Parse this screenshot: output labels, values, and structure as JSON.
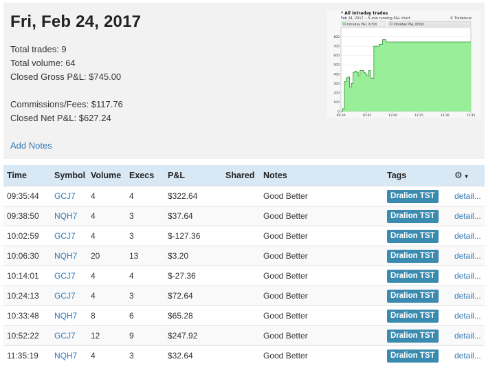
{
  "summary": {
    "date": "Fri, Feb 24, 2017",
    "total_trades": "Total trades: 9",
    "total_volume": "Total volume: 64",
    "closed_gross": "Closed Gross P&L: $745.00",
    "commissions": "Commissions/Fees: $117.76",
    "closed_net": "Closed Net P&L: $627.24",
    "add_notes": "Add Notes"
  },
  "chart_data": {
    "type": "area",
    "title": "* All intraday trades",
    "subtitle": "Feb 24, 2017 -- 5-min running P&L chart",
    "brand": "© Tradervue",
    "legend": [
      "Intraday P&L (USD)",
      "Intraday P&L (USD)"
    ],
    "x_ticks": [
      "09:30",
      "10:45",
      "12:00",
      "13:15",
      "14:30",
      "15:45"
    ],
    "y_ticks": [
      0,
      100,
      200,
      300,
      400,
      500,
      600,
      700,
      800
    ],
    "ylim": [
      0,
      900
    ],
    "series": [
      {
        "name": "Intraday P&L (USD)",
        "x": [
          "09:30",
          "09:35",
          "09:40",
          "09:45",
          "09:50",
          "09:55",
          "10:00",
          "10:05",
          "10:10",
          "10:15",
          "10:20",
          "10:25",
          "10:30",
          "10:35",
          "10:40",
          "10:45",
          "10:50",
          "10:55",
          "11:00",
          "11:05",
          "11:10",
          "11:15",
          "11:20",
          "11:30",
          "11:40",
          "12:00",
          "13:15",
          "14:30",
          "15:45"
        ],
        "values": [
          0,
          30,
          320,
          360,
          370,
          260,
          300,
          420,
          430,
          420,
          380,
          440,
          440,
          420,
          400,
          380,
          440,
          360,
          350,
          700,
          700,
          700,
          720,
          770,
          745,
          745,
          745,
          745,
          745
        ]
      }
    ],
    "colors": {
      "fill": "#99ee99",
      "line": "#2f8f2f"
    },
    "grid": true
  },
  "table": {
    "headers": [
      "Time",
      "Symbol",
      "Volume",
      "Execs",
      "P&L",
      "Shared",
      "Notes",
      "Tags"
    ],
    "settings_icon": "gear-icon",
    "rows": [
      {
        "time": "09:35:44",
        "symbol": "GCJ7",
        "volume": "4",
        "execs": "4",
        "pnl": "$322.64",
        "shared": "",
        "notes": "Good Better",
        "tag": "Dralion TST",
        "detail": "detail..."
      },
      {
        "time": "09:38:50",
        "symbol": "NQH7",
        "volume": "4",
        "execs": "3",
        "pnl": "$37.64",
        "shared": "",
        "notes": "Good Better",
        "tag": "Dralion TST",
        "detail": "detail..."
      },
      {
        "time": "10:02:59",
        "symbol": "GCJ7",
        "volume": "4",
        "execs": "3",
        "pnl": "$-127.36",
        "shared": "",
        "notes": "Good Better",
        "tag": "Dralion TST",
        "detail": "detail..."
      },
      {
        "time": "10:06:30",
        "symbol": "NQH7",
        "volume": "20",
        "execs": "13",
        "pnl": "$3.20",
        "shared": "",
        "notes": "Good Better",
        "tag": "Dralion TST",
        "detail": "detail..."
      },
      {
        "time": "10:14:01",
        "symbol": "GCJ7",
        "volume": "4",
        "execs": "4",
        "pnl": "$-27.36",
        "shared": "",
        "notes": "Good Better",
        "tag": "Dralion TST",
        "detail": "detail..."
      },
      {
        "time": "10:24:13",
        "symbol": "GCJ7",
        "volume": "4",
        "execs": "3",
        "pnl": "$72.64",
        "shared": "",
        "notes": "Good Better",
        "tag": "Dralion TST",
        "detail": "detail..."
      },
      {
        "time": "10:33:48",
        "symbol": "NQH7",
        "volume": "8",
        "execs": "6",
        "pnl": "$65.28",
        "shared": "",
        "notes": "Good Better",
        "tag": "Dralion TST",
        "detail": "detail..."
      },
      {
        "time": "10:52:22",
        "symbol": "GCJ7",
        "volume": "12",
        "execs": "9",
        "pnl": "$247.92",
        "shared": "",
        "notes": "Good Better",
        "tag": "Dralion TST",
        "detail": "detail..."
      },
      {
        "time": "11:35:19",
        "symbol": "NQH7",
        "volume": "4",
        "execs": "3",
        "pnl": "$32.64",
        "shared": "",
        "notes": "Good Better",
        "tag": "Dralion TST",
        "detail": "detail..."
      }
    ]
  }
}
